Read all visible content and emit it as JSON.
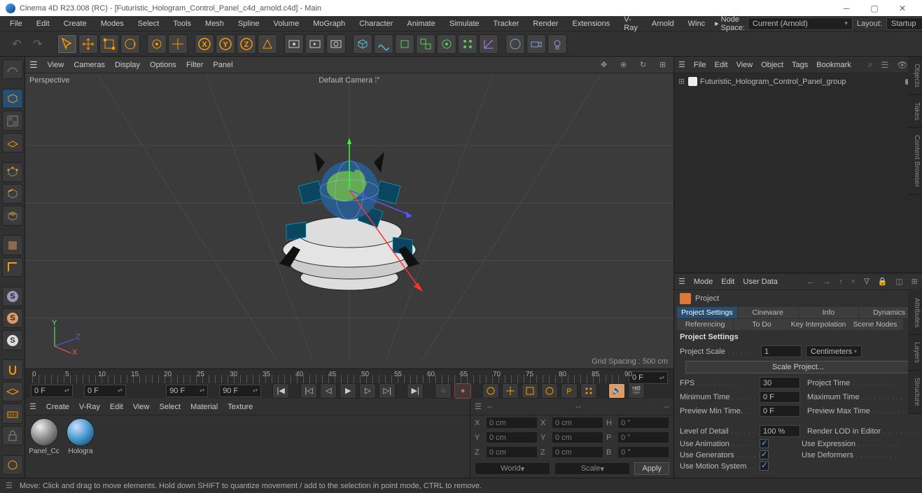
{
  "title": "Cinema 4D R23.008 (RC) - [Futuristic_Hologram_Control_Panel_c4d_arnold.c4d] - Main",
  "mainMenu": [
    "File",
    "Edit",
    "Create",
    "Modes",
    "Select",
    "Tools",
    "Mesh",
    "Spline",
    "Volume",
    "MoGraph",
    "Character",
    "Animate",
    "Simulate",
    "Tracker",
    "Render",
    "Extensions",
    "V-Ray",
    "Arnold",
    "Winc"
  ],
  "breadcrumb": {
    "a": "Node Space:",
    "cur": "Current (Arnold)"
  },
  "layout": {
    "label": "Layout:",
    "value": "Startup"
  },
  "viewportMenu": [
    "View",
    "Cameras",
    "Display",
    "Options",
    "Filter",
    "Panel"
  ],
  "viewport": {
    "persp": "Perspective",
    "camera": "Default Camera",
    "grid": "Grid Spacing : 500 cm"
  },
  "ruler": {
    "ticks": [
      0,
      5,
      10,
      15,
      20,
      25,
      30,
      35,
      40,
      45,
      50,
      55,
      60,
      65,
      70,
      75,
      80,
      85,
      90
    ],
    "goto": "0 F"
  },
  "transport": {
    "a": "0 F",
    "b": "0 F",
    "c": "90 F",
    "d": "90 F"
  },
  "matMenu": [
    "Create",
    "V-Ray",
    "Edit",
    "View",
    "Select",
    "Material",
    "Texture"
  ],
  "materials": [
    {
      "name": "Panel_Cc"
    },
    {
      "name": "Hologra"
    }
  ],
  "coords": {
    "dashes": "--",
    "rows": [
      {
        "ax": "X",
        "p": "0 cm",
        "sAx": "X",
        "s": "0 cm",
        "rAx": "H",
        "r": "0 °"
      },
      {
        "ax": "Y",
        "p": "0 cm",
        "sAx": "Y",
        "s": "0 cm",
        "rAx": "P",
        "r": "0 °"
      },
      {
        "ax": "Z",
        "p": "0 cm",
        "sAx": "Z",
        "s": "0 cm",
        "rAx": "B",
        "r": "0 °"
      }
    ],
    "world": "World",
    "scale": "Scale",
    "apply": "Apply"
  },
  "omMenu": [
    "File",
    "Edit",
    "View",
    "Object",
    "Tags",
    "Bookmark"
  ],
  "omItem": "Futuristic_Hologram_Control_Panel_group",
  "attrMenu": [
    "Mode",
    "Edit",
    "User Data"
  ],
  "attrHead": "Project",
  "attrTabs": [
    "Project Settings",
    "Cineware",
    "Info",
    "Dynamics",
    "Referencing",
    "To Do",
    "Key Interpolation",
    "Scene Nodes"
  ],
  "sectionTitle": "Project Settings",
  "props": {
    "scaleLabel": "Project Scale",
    "scaleVal": "1",
    "scaleUnit": "Centimeters",
    "scaleBtn": "Scale Project...",
    "fpsLabel": "FPS",
    "fpsVal": "30",
    "projTime": "Project Time",
    "minTimeL": "Minimum Time",
    "minTimeV": "0 F",
    "maxTime": "Maximum Time",
    "prevMinL": "Preview Min Time.",
    "prevMinV": "0 F",
    "prevMax": "Preview Max Time",
    "lodL": "Level of Detail",
    "lodV": "100 %",
    "renderLod": "Render LOD in Editor",
    "useAnim": "Use Animation",
    "useExpr": "Use Expression",
    "useGen": "Use Generators",
    "useDef": "Use Deformers",
    "useMotion": "Use Motion System"
  },
  "sideTabs": [
    "Objects",
    "Takes",
    "Content Browser",
    "Attributes",
    "Layers",
    "Structure"
  ],
  "status": "Move: Click and drag to move elements. Hold down SHIFT to quantize movement / add to the selection in point mode, CTRL to remove."
}
